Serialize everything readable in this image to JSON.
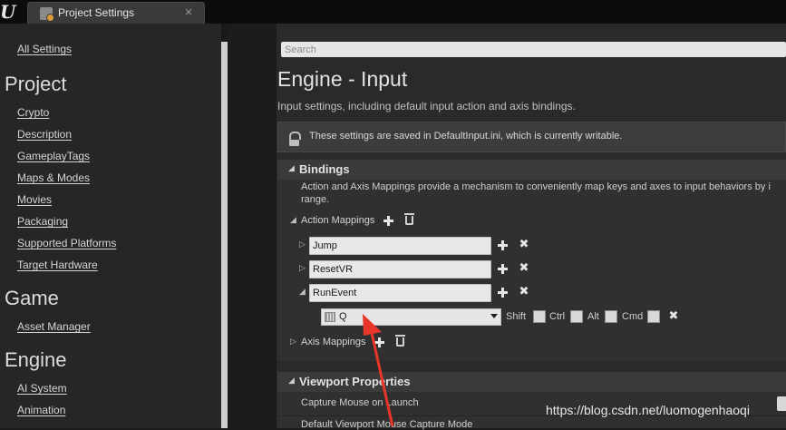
{
  "tab": {
    "title": "Project Settings",
    "close": "×"
  },
  "sidebar": {
    "all_settings": "All Settings",
    "project_heading": "Project",
    "project_items": [
      "Crypto",
      "Description",
      "GameplayTags",
      "Maps & Modes",
      "Movies",
      "Packaging",
      "Supported Platforms",
      "Target Hardware"
    ],
    "game_heading": "Game",
    "game_items": [
      "Asset Manager"
    ],
    "engine_heading": "Engine",
    "engine_items": [
      "AI System",
      "Animation"
    ]
  },
  "search": {
    "placeholder": "Search"
  },
  "page": {
    "title": "Engine - Input",
    "description": "Input settings, including default input action and axis bindings.",
    "notice": "These settings are saved in DefaultInput.ini, which is currently writable."
  },
  "bindings": {
    "header": "Bindings",
    "description_line1": "Action and Axis Mappings provide a mechanism to conveniently map keys and axes to input behaviors by i",
    "description_line2": "range.",
    "action_mappings_label": "Action Mappings",
    "actions": [
      {
        "name": "Jump",
        "expanded": false
      },
      {
        "name": "ResetVR",
        "expanded": false
      },
      {
        "name": "RunEvent",
        "expanded": true
      }
    ],
    "key_binding": {
      "key": "Q",
      "modifiers": [
        {
          "label": "Shift",
          "checked": false
        },
        {
          "label": "Ctrl",
          "checked": false
        },
        {
          "label": "Alt",
          "checked": false
        },
        {
          "label": "Cmd",
          "checked": false
        }
      ]
    },
    "axis_mappings_label": "Axis Mappings"
  },
  "viewport": {
    "header": "Viewport Properties",
    "props": [
      "Capture Mouse on Launch",
      "Default Viewport Mouse Capture Mode"
    ]
  },
  "watermark": "https://blog.csdn.net/luomogenhaoqi",
  "colors": {
    "annotation_arrow": "#e8372a"
  }
}
